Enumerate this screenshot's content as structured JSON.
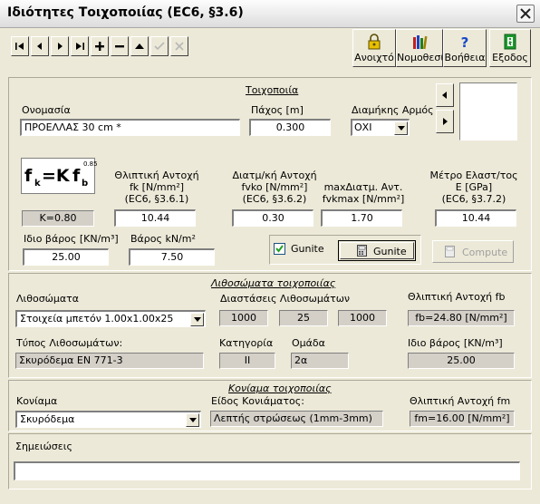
{
  "window": {
    "title": "Ιδιότητες Τοιχοποιίας (EC6, §3.6)"
  },
  "toolbar": {
    "nav_icons": [
      "first-icon",
      "previous-icon",
      "next-icon",
      "last-icon",
      "add-icon",
      "delete-icon",
      "up-icon",
      "check-icon",
      "cancel-icon"
    ],
    "open_label": "Ανοιχτό",
    "legislation_label": "Νομοθεσία",
    "help_label": "Βοήθεια",
    "exit_label": "Εξοδος"
  },
  "masonry": {
    "section_title": "Τοιχοποιία",
    "name_label": "Ονομασία",
    "name_value": "ΠΡΟΕΛΛΑΣ 30 cm *",
    "thickness_label": "Πάχος [m]",
    "thickness_value": "0.300",
    "joint_label": "Διαμήκης Αρμός",
    "joint_value": "ΟΧΙ",
    "formula": {
      "f": "f",
      "k_sub": "k",
      "eq": "=K",
      "fb": "f",
      "b_sub": "b",
      "exp": "0.85"
    },
    "k_value": "K=0.80",
    "fk_label_1": "Θλιπτική Αντοχή",
    "fk_label_2": "fk [N/mm²]",
    "fk_label_3": "(EC6, §3.6.1)",
    "fk_value": "10.44",
    "fvko_label_1": "Διατμ/κή Αντοχή",
    "fvko_label_2": "fvko [N/mm²]",
    "fvko_label_3": "(EC6, §3.6.2)",
    "fvko_value": "0.30",
    "fvkmax_label_1": "maxΔιατμ. Αντ.",
    "fvkmax_label_2": "fvkmax [N/mm²]",
    "fvkmax_value": "1.70",
    "e_label_1": "Μέτρο Ελαστ/τος",
    "e_label_2": "E [GPa]",
    "e_label_3": "(EC6, §3.7.2)",
    "e_value": "10.44",
    "self_weight_label": "Ιδιο βάρος [KN/m³]",
    "self_weight_value": "25.00",
    "weight_label": "Βάρος kN/m²",
    "weight_value": "7.50",
    "gunite_check_label": "Gunite",
    "gunite_checked": true,
    "gunite_button_label": "Gunite",
    "compute_label": "Compute"
  },
  "units": {
    "section_title": "Λιθοσώματα τοιχοποιίας",
    "units_label": "Λιθοσώματα",
    "units_value": "Στοιχεία μπετόν 1.00x1.00x25",
    "dims_label": "Διαστάσεις Λιθοσωμάτων",
    "dims": [
      "1000",
      "25",
      "1000"
    ],
    "fb_label": "Θλιπτική Αντοχή fb",
    "fb_value": "fb=24.80  [N/mm²]",
    "type_label": "Τύπος Λιθοσωμάτων:",
    "type_value": "Σκυρόδεμα EN 771-3",
    "category_label": "Κατηγορία",
    "category_value": "II",
    "group_label": "Ομάδα",
    "group_value": "2α",
    "unit_weight_label": "Ιδιο βάρος [KN/m³]",
    "unit_weight_value": "25.00"
  },
  "mortar": {
    "section_title": "Κονίαμα τοιχοποιίας",
    "mortar_label": "Κονίαμα",
    "mortar_value": "Σκυρόδεμα",
    "kind_label": "Είδος Κονιάματος:",
    "kind_value": "Λεπτής στρώσεως (1mm-3mm)",
    "fm_label": "Θλιπτική Αντοχή fm",
    "fm_value": "fm=16.00  [N/mm²]"
  },
  "notes": {
    "label": "Σημειώσεις",
    "value": ""
  }
}
